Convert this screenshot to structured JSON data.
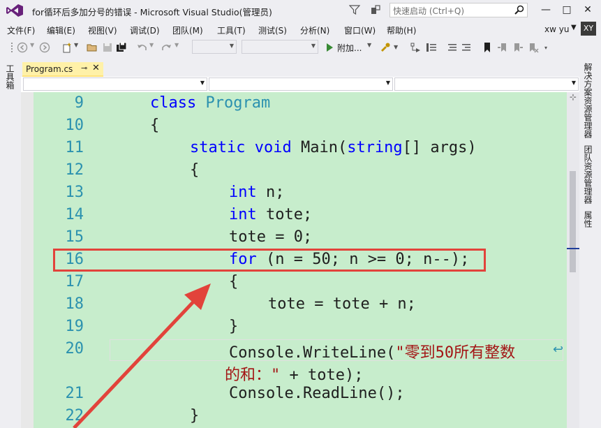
{
  "window": {
    "title": "for循环后多加分号的错误 - Microsoft Visual Studio(管理员)",
    "quick_launch_placeholder": "快速启动 (Ctrl+Q)",
    "min": "—",
    "max": "□",
    "close": "✕"
  },
  "menu": [
    "文件(F)",
    "编辑(E)",
    "视图(V)",
    "调试(D)",
    "团队(M)",
    "工具(T)",
    "测试(S)",
    "分析(N)",
    "窗口(W)",
    "帮助(H)"
  ],
  "user": {
    "name": "xw yu",
    "initials": "XY"
  },
  "toolbar": {
    "run_label": "附加..."
  },
  "toolbox_label": "工具箱",
  "right_panels": [
    "解决方案资源管理器",
    "团队资源管理器",
    "属性"
  ],
  "tab": {
    "label": "Program.cs",
    "pin": "⊸",
    "close": "✕"
  },
  "editor": {
    "lines": [
      {
        "n": "9",
        "tokens": [
          [
            "kw",
            "class"
          ],
          [
            "",
            " "
          ],
          [
            "ty",
            "Program"
          ]
        ]
      },
      {
        "n": "10",
        "tokens": [
          [
            "",
            "{"
          ]
        ]
      },
      {
        "n": "11",
        "tokens": [
          [
            "kw",
            "static"
          ],
          [
            "",
            " "
          ],
          [
            "kw",
            "void"
          ],
          [
            "",
            " Main("
          ],
          [
            "kw",
            "string"
          ],
          [
            "",
            "[] args)"
          ]
        ]
      },
      {
        "n": "12",
        "tokens": [
          [
            "",
            "{"
          ]
        ]
      },
      {
        "n": "13",
        "tokens": [
          [
            "kw",
            "int"
          ],
          [
            "",
            " n;"
          ]
        ]
      },
      {
        "n": "14",
        "tokens": [
          [
            "kw",
            "int"
          ],
          [
            "",
            " tote;"
          ]
        ]
      },
      {
        "n": "15",
        "tokens": [
          [
            "",
            "tote = 0;"
          ]
        ]
      },
      {
        "n": "16",
        "tokens": [
          [
            "kw",
            "for"
          ],
          [
            "",
            " (n = 50; n >= 0; n--);"
          ]
        ]
      },
      {
        "n": "17",
        "tokens": [
          [
            "",
            "{"
          ]
        ]
      },
      {
        "n": "18",
        "tokens": [
          [
            "",
            "tote = tote + n;"
          ]
        ]
      },
      {
        "n": "19",
        "tokens": [
          [
            "",
            "}"
          ]
        ]
      },
      {
        "n": "20",
        "tokens": [
          [
            "",
            "Console.WriteLine("
          ],
          [
            "st",
            "\"零到50所有整数"
          ]
        ]
      },
      {
        "n": "",
        "tokens": [
          [
            "st",
            "的和：\""
          ],
          [
            "",
            " + tote);"
          ]
        ]
      },
      {
        "n": "21",
        "tokens": [
          [
            "",
            "Console.ReadLine();"
          ]
        ]
      },
      {
        "n": "22",
        "tokens": [
          [
            "",
            "}"
          ]
        ]
      }
    ]
  }
}
